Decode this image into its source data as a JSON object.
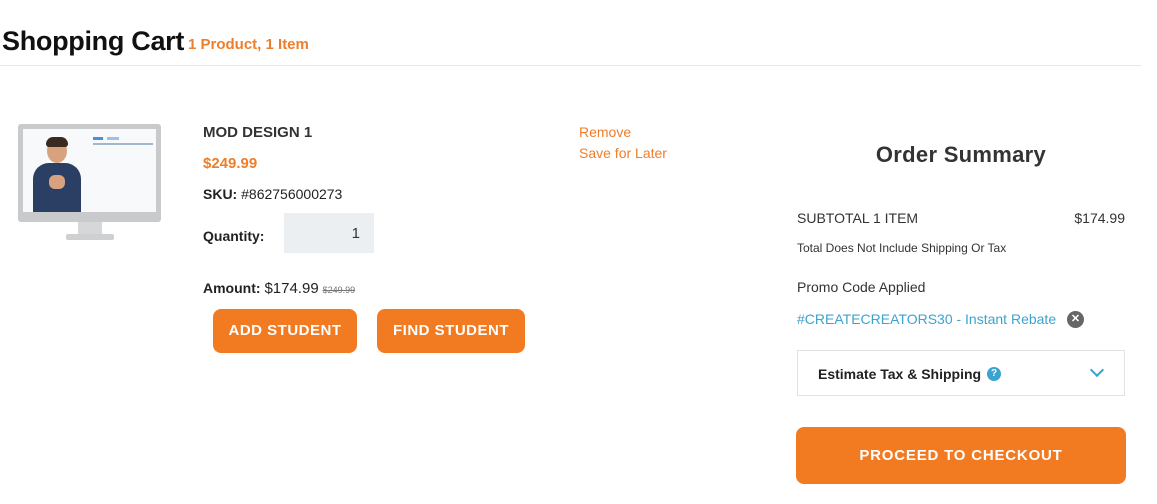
{
  "header": {
    "title": "Shopping Cart",
    "count": "1 Product, 1 Item"
  },
  "product": {
    "name": "MOD DESIGN 1",
    "price": "$249.99",
    "sku_label": "SKU:",
    "sku_value": "#862756000273",
    "quantity_label": "Quantity:",
    "quantity_value": "1",
    "amount_label": "Amount:",
    "amount_value": "$174.99",
    "amount_original": "$249.99",
    "add_student_label": "ADD STUDENT",
    "find_student_label": "FIND STUDENT",
    "remove_label": "Remove",
    "save_later_label": "Save for Later"
  },
  "summary": {
    "title": "Order Summary",
    "subtotal_label": "SUBTOTAL 1 ITEM",
    "subtotal_value": "$174.99",
    "tax_note": "Total Does Not Include Shipping Or Tax",
    "promo_label": "Promo Code Applied",
    "promo_code": "#CREATECREATORS30 - Instant Rebate",
    "estimate_label": "Estimate Tax & Shipping",
    "checkout_label": "PROCEED TO CHECKOUT"
  },
  "colors": {
    "accent": "#f27b22",
    "link": "#3ba3d0"
  },
  "icons": {
    "promo_remove": "close-circle-icon",
    "help": "question-circle-icon",
    "expand": "chevron-down-icon"
  }
}
